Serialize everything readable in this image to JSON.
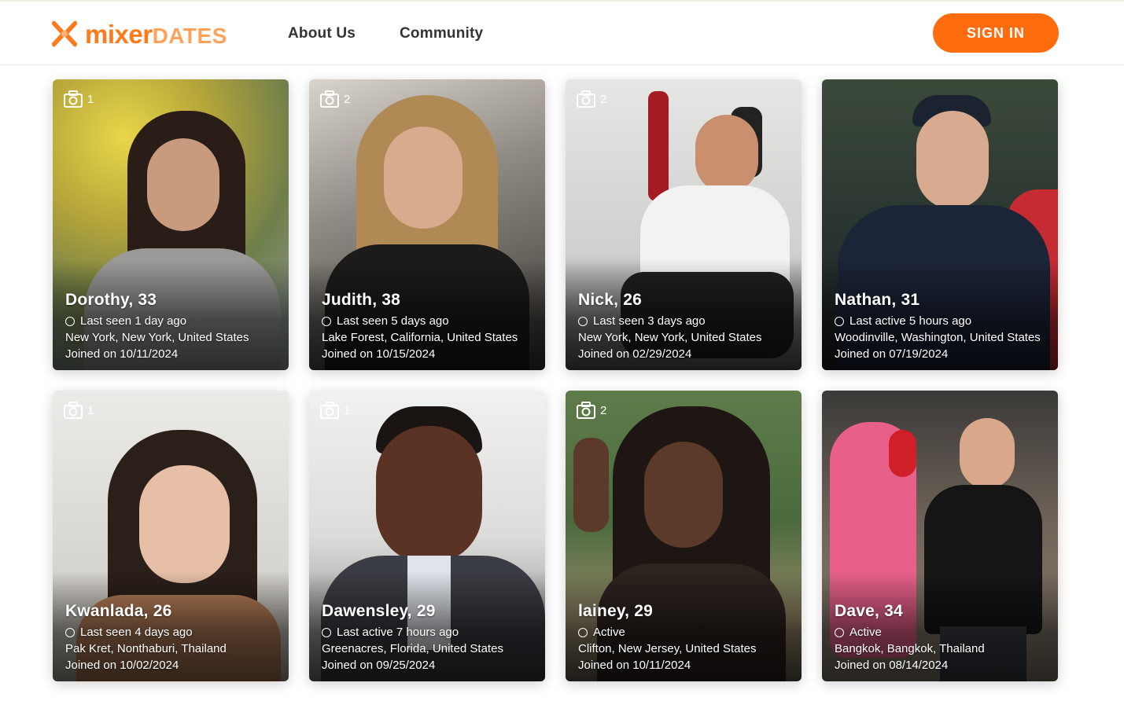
{
  "brand": {
    "mixer": "mixer",
    "dates": "DATES",
    "accent": "#ff6c0e"
  },
  "nav": {
    "about": "About Us",
    "community": "Community",
    "signin": "SIGN IN"
  },
  "profiles": [
    {
      "name": "Dorothy, 33",
      "photos": "1",
      "status": "Last seen 1 day ago",
      "location": "New York, New York, United States",
      "joined": "Joined on 10/11/2024"
    },
    {
      "name": "Judith, 38",
      "photos": "2",
      "status": "Last seen 5 days ago",
      "location": "Lake Forest, California, United States",
      "joined": "Joined on 10/15/2024"
    },
    {
      "name": "Nick, 26",
      "photos": "2",
      "status": "Last seen 3 days ago",
      "location": "New York, New York, United States",
      "joined": "Joined on 02/29/2024"
    },
    {
      "name": "Nathan, 31",
      "photos": "",
      "status": "Last active 5 hours ago",
      "location": "Woodinville, Washington, United States",
      "joined": "Joined on 07/19/2024"
    },
    {
      "name": "Kwanlada, 26",
      "photos": "1",
      "status": "Last seen 4 days ago",
      "location": "Pak Kret, Nonthaburi, Thailand",
      "joined": "Joined on 10/02/2024"
    },
    {
      "name": "Dawensley, 29",
      "photos": "1",
      "status": "Last active 7 hours ago",
      "location": "Greenacres, Florida, United States",
      "joined": "Joined on 09/25/2024"
    },
    {
      "name": "lainey, 29",
      "photos": "2",
      "status": "Active",
      "location": "Clifton, New Jersey, United States",
      "joined": "Joined on 10/11/2024"
    },
    {
      "name": "Dave, 34",
      "photos": "",
      "status": "Active",
      "location": "Bangkok, Bangkok, Thailand",
      "joined": "Joined on 08/14/2024"
    }
  ]
}
